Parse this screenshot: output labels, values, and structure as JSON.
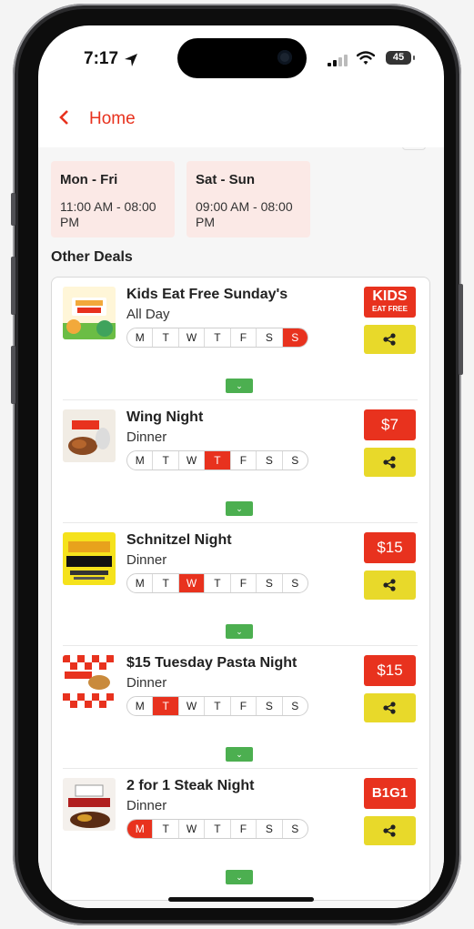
{
  "status_bar": {
    "time": "7:17",
    "battery": "45"
  },
  "nav": {
    "back_label": "Home"
  },
  "hours": [
    {
      "days": "Mon - Fri",
      "time": "11:00 AM - 08:00 PM"
    },
    {
      "days": "Sat - Sun",
      "time": "09:00 AM - 08:00 PM"
    }
  ],
  "section_title": "Other Deals",
  "day_letters": [
    "M",
    "T",
    "W",
    "T",
    "F",
    "S",
    "S"
  ],
  "deals": [
    {
      "title": "Kids Eat Free Sunday's",
      "subtitle": "All Day",
      "active_day": 6,
      "badge": "KIDS",
      "badge_sub": "EAT FREE"
    },
    {
      "title": "Wing Night",
      "subtitle": "Dinner",
      "active_day": 3,
      "badge": "$7"
    },
    {
      "title": "Schnitzel Night",
      "subtitle": "Dinner",
      "active_day": 2,
      "badge": "$15"
    },
    {
      "title": "$15 Tuesday Pasta Night",
      "subtitle": "Dinner",
      "active_day": 1,
      "badge": "$15"
    },
    {
      "title": "2 for 1 Steak Night",
      "subtitle": "Dinner",
      "active_day": 0,
      "badge": "B1G1"
    }
  ],
  "colors": {
    "accent": "#e8321e",
    "share": "#e8d92a",
    "expand": "#4caf50",
    "hours_bg": "#fbe9e6"
  },
  "icons": {
    "back": "chevron-left-icon",
    "share": "share-icon",
    "expand": "chevron-down-icon"
  }
}
